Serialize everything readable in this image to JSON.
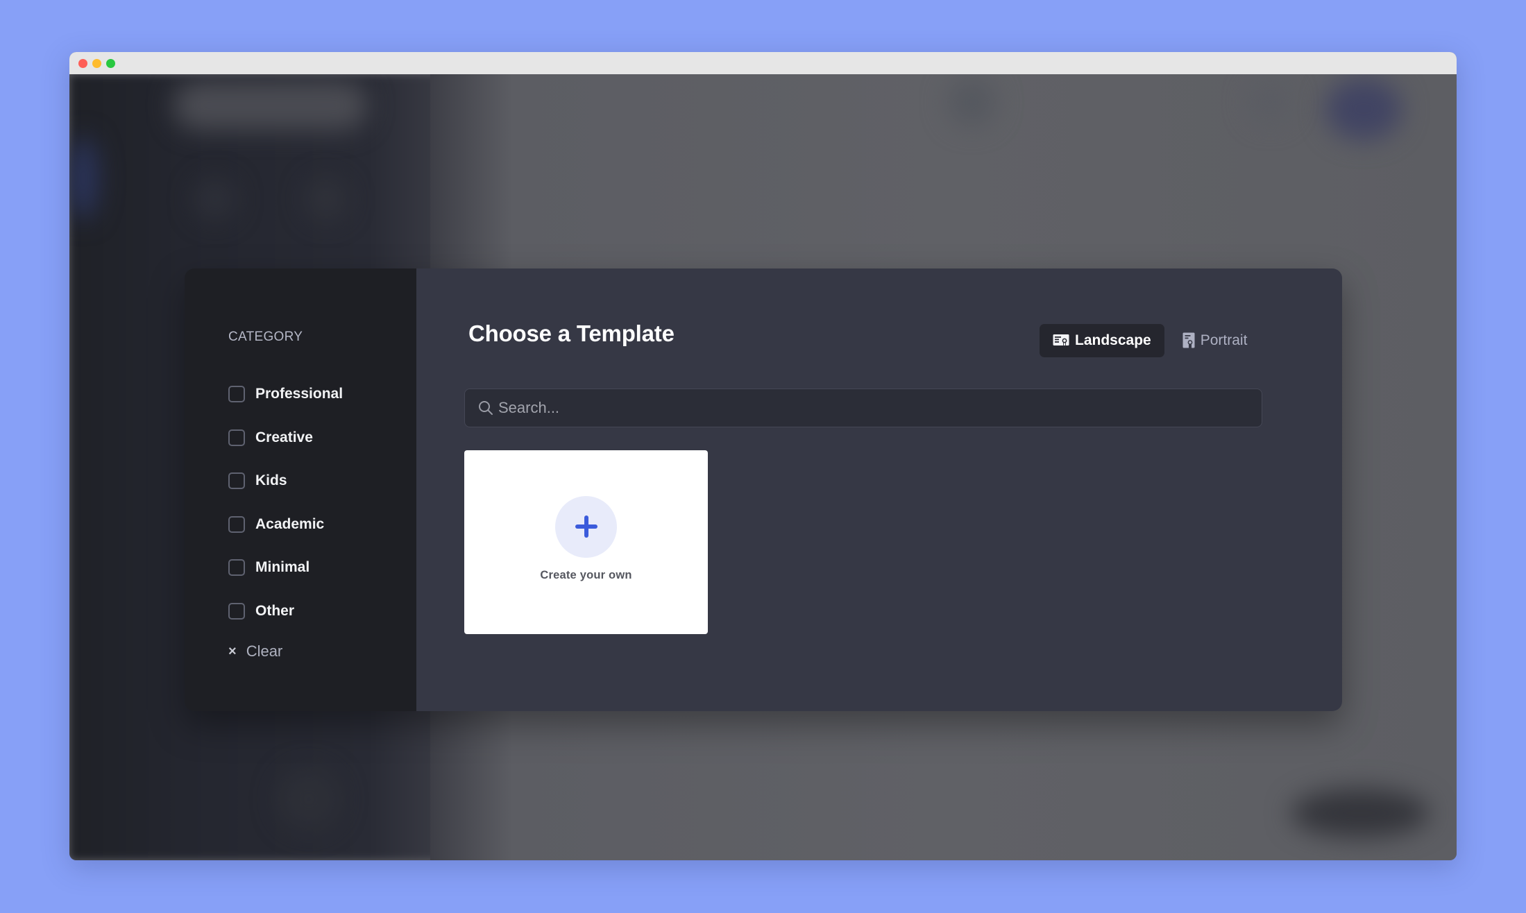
{
  "window": {
    "traffic_lights": [
      "close",
      "minimize",
      "maximize"
    ]
  },
  "modal": {
    "sidebar": {
      "heading": "CATEGORY",
      "categories": [
        {
          "label": "Professional",
          "checked": false
        },
        {
          "label": "Creative",
          "checked": false
        },
        {
          "label": "Kids",
          "checked": false
        },
        {
          "label": "Academic",
          "checked": false
        },
        {
          "label": "Minimal",
          "checked": false
        },
        {
          "label": "Other",
          "checked": false
        }
      ],
      "clear_icon": "×",
      "clear_label": "Clear"
    },
    "title": "Choose a Template",
    "orientation": {
      "selected": "Landscape",
      "options": [
        {
          "label": "Landscape",
          "icon": "certificate-landscape-icon"
        },
        {
          "label": "Portrait",
          "icon": "certificate-portrait-icon"
        }
      ]
    },
    "search": {
      "placeholder": "Search...",
      "value": ""
    },
    "create_card": {
      "icon": "plus-icon",
      "label": "Create your own"
    }
  },
  "colors": {
    "accent": "#3b5bdb",
    "accent_soft": "#e8ebfa",
    "page_background": "#87a0f7",
    "sidebar_bg": "#1e1f24",
    "content_bg": "#363845"
  }
}
